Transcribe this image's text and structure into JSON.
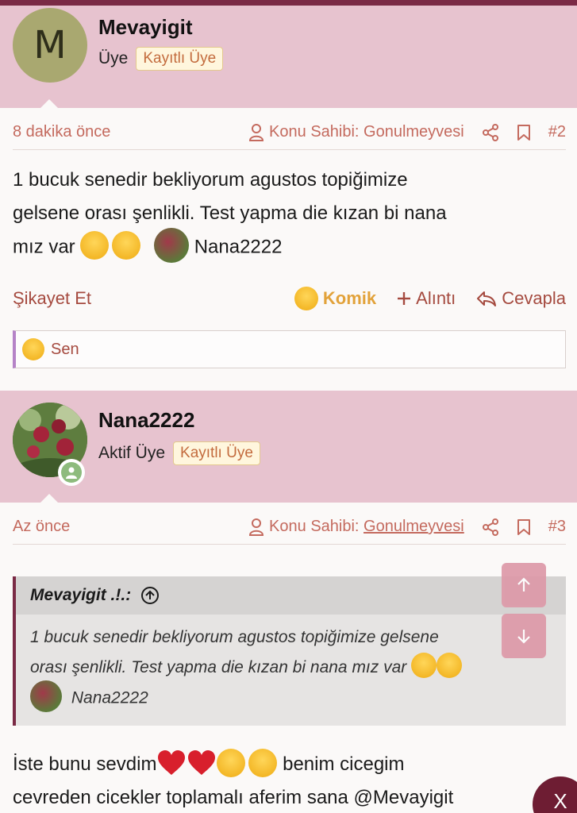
{
  "post1": {
    "avatar_letter": "M",
    "username": "Mevayigit",
    "role": "Üye",
    "badge": "Kayıtlı Üye",
    "time": "8 dakika önce",
    "author_label": "Konu Sahibi: Gonulmeyvesi",
    "number": "#2",
    "text_line1": "1 bucuk senedir bekliyorum agustos topiğimize",
    "text_line2": "gelsene orası şenlikli. Test yapma die kızan bi nana",
    "text_line3_a": "mız var",
    "text_line3_b": "Nana2222",
    "actions": {
      "report": "Şikayet Et",
      "reaction": "Komik",
      "quote": "Alıntı",
      "reply": "Cevapla"
    },
    "reacted_by": "Sen"
  },
  "post2": {
    "username": "Nana2222",
    "role": "Aktif Üye",
    "badge": "Kayıtlı Üye",
    "time": "Az önce",
    "author_label": "Konu Sahibi: ",
    "author_name": "Gonulmeyvesi",
    "number": "#3",
    "quote": {
      "author": "Mevayigit .!.:",
      "line1": "1 bucuk senedir bekliyorum agustos topiğimize gelsene",
      "line2": "orası şenlikli. Test yapma die kızan bi nana mız var",
      "line3": "Nana2222"
    },
    "text_line1_a": "İste bunu sevdim",
    "text_line1_b": "benim cicegim",
    "text_line2": "cevreden cicekler toplamalı aferim sana @Mevayigit"
  },
  "close_label": "X",
  "colors": {
    "band": "#e7c3cf",
    "accent": "#7a2a45",
    "meta": "#c46a5e",
    "link": "#a54a3f",
    "funny": "#e2a23a"
  }
}
